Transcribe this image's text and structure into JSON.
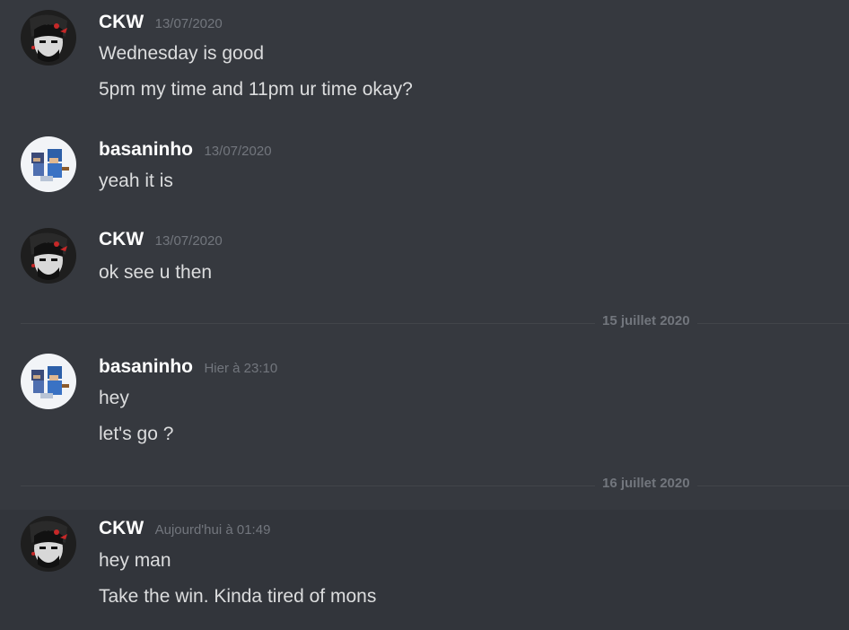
{
  "messages": [
    {
      "author": "CKW",
      "timestamp": "13/07/2020",
      "lines": [
        "Wednesday is good",
        "5pm my time and 11pm ur time okay?"
      ]
    },
    {
      "author": "basaninho",
      "timestamp": "13/07/2020",
      "lines": [
        "yeah it is"
      ]
    },
    {
      "author": "CKW",
      "timestamp": "13/07/2020",
      "lines": [
        "ok see u then"
      ]
    },
    {
      "author": "basaninho",
      "timestamp": "Hier à 23:10",
      "lines": [
        "hey",
        "let's go ?"
      ]
    },
    {
      "author": "CKW",
      "timestamp": "Aujourd'hui à 01:49",
      "lines": [
        "hey man",
        "Take the win. Kinda tired of mons"
      ]
    }
  ],
  "dividers": [
    "15 juillet 2020",
    "16 juillet 2020"
  ],
  "colors": {
    "background": "#36393f",
    "username": "#ffffff",
    "message_text": "#dcddde",
    "timestamp": "#72767d"
  },
  "icons": {
    "ckw_avatar": "dark-portrait-avatar-icon",
    "basaninho_avatar": "pixel-characters-avatar-icon"
  }
}
